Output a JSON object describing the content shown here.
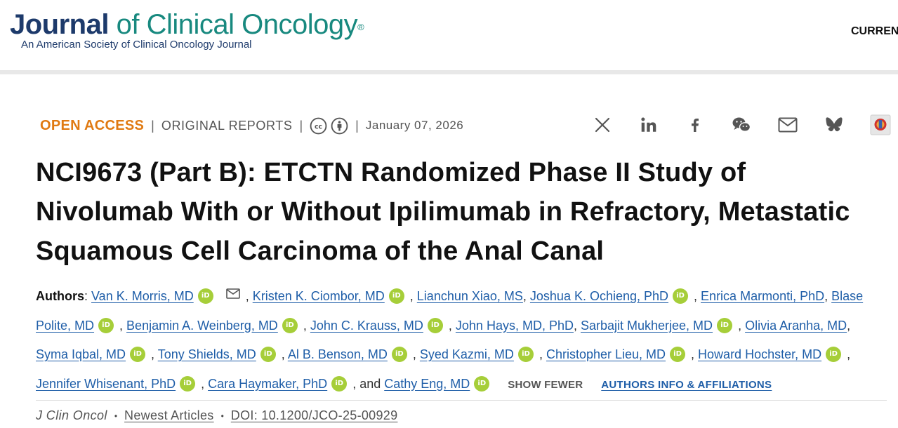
{
  "header": {
    "logo_journal": "Journal",
    "logo_rest": " of Clinical Oncology",
    "logo_reg": "®",
    "logo_subtitle": "An American Society of Clinical Oncology Journal",
    "nav_current": "CURREN"
  },
  "meta": {
    "open_access": "OPEN ACCESS",
    "separator": "|",
    "report_type": "ORIGINAL REPORTS",
    "date": "January 07, 2026"
  },
  "share_icons": [
    "x-icon",
    "linkedin-icon",
    "facebook-icon",
    "wechat-icon",
    "email-icon",
    "bluesky-icon",
    "mendeley-icon"
  ],
  "article": {
    "title": "NCI9673 (Part B): ETCTN Randomized Phase II Study of Nivolumab With or Without Ipilimumab in Refractory, Metastatic Squamous Cell Carcinoma of the Anal Canal"
  },
  "authors": {
    "label": "Authors",
    "colon": ": ",
    "comma": ", ",
    "and": ", and ",
    "orcid_text": "iD",
    "list": [
      "Van K. Morris, MD",
      "Kristen K. Ciombor, MD",
      "Lianchun Xiao, MS",
      "Joshua K. Ochieng, PhD",
      "Enrica Marmonti, PhD",
      "Blase Polite, MD",
      "Benjamin A. Weinberg, MD",
      "John C. Krauss, MD",
      "John Hays, MD, PhD",
      "Sarbajit Mukherjee, MD",
      "Olivia Aranha, MD",
      "Syma Iqbal, MD",
      "Tony Shields, MD",
      "Al B. Benson, MD",
      "Syed Kazmi, MD",
      "Christopher Lieu, MD",
      "Howard Hochster, MD",
      "Jennifer Whisenant, PhD",
      "Cara Haymaker, PhD",
      "Cathy Eng, MD"
    ],
    "show_fewer": "SHOW FEWER",
    "info_affiliations": "AUTHORS INFO & AFFILIATIONS"
  },
  "citation": {
    "journal": "J Clin Oncol",
    "bullet": "•",
    "section": "Newest Articles",
    "doi": "DOI: 10.1200/JCO-25-00929"
  },
  "colors": {
    "accent_orange": "#e07a12",
    "link_blue": "#1f5ea8",
    "logo_navy": "#1d3a6b",
    "logo_teal": "#18897f",
    "orcid_green": "#a6ce39"
  }
}
